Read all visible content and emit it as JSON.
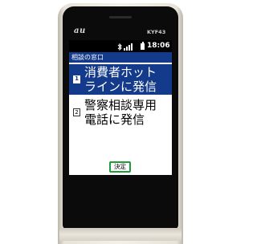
{
  "device": {
    "brand": "au",
    "model": "KYF43"
  },
  "statusbar": {
    "time": "18:06",
    "icons": [
      "bluetooth-icon",
      "signal-icon",
      "battery-icon"
    ]
  },
  "screen": {
    "title": "相談の窓口",
    "menu": [
      {
        "number": "1",
        "line1": "消費者ホット",
        "line2": "ラインに発信",
        "selected": true
      },
      {
        "number": "2",
        "line1": "警察相談専用",
        "line2": "電話に発信",
        "selected": false
      }
    ],
    "softkey": {
      "center": "決定"
    }
  },
  "colors": {
    "highlight": "#143a8c",
    "softkey_border": "#1e9d3a",
    "phone_bezel": "#0b0b0b"
  }
}
